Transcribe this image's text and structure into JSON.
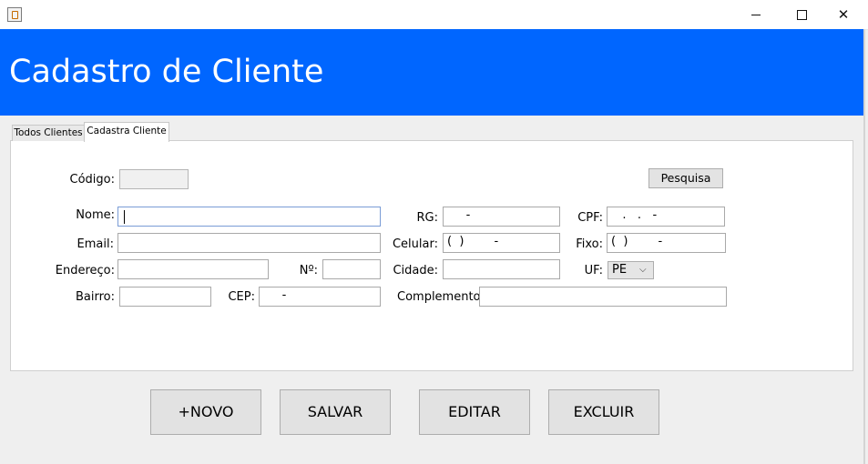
{
  "window": {
    "icons": {
      "app": "java-cup-icon",
      "minimize": "minimize-icon",
      "maximize": "maximize-icon",
      "close": "close-icon"
    },
    "close_glyph": "✕"
  },
  "header": {
    "title": "Cadastro de Cliente",
    "background": "#0066ff"
  },
  "tabs": [
    {
      "label": "Todos Clientes",
      "selected": false
    },
    {
      "label": "Cadastra Cliente",
      "selected": true
    }
  ],
  "form": {
    "codigo": {
      "label": "Código:",
      "value": ""
    },
    "pesquisa_button": "Pesquisa",
    "nome": {
      "label": "Nome:",
      "value": ""
    },
    "rg": {
      "label": "RG:",
      "value": "     -"
    },
    "cpf": {
      "label": "CPF:",
      "value": "   .   .   -"
    },
    "email": {
      "label": "Email:",
      "value": ""
    },
    "celular": {
      "label": "Celular:",
      "value": "(  )        -"
    },
    "fixo": {
      "label": "Fixo:",
      "value": "(  )        -"
    },
    "endereco": {
      "label": "Endereço:",
      "value": ""
    },
    "numero": {
      "label": "Nº:",
      "value": ""
    },
    "cidade": {
      "label": "Cidade:",
      "value": ""
    },
    "uf": {
      "label": "UF:",
      "value": "PE"
    },
    "bairro": {
      "label": "Bairro:",
      "value": ""
    },
    "cep": {
      "label": "CEP:",
      "value": "     -"
    },
    "complemento": {
      "label": "Complemento",
      "value": ""
    }
  },
  "actions": {
    "novo": "+NOVO",
    "salvar": "SALVAR",
    "editar": "EDITAR",
    "excluir": "EXCLUIR"
  }
}
